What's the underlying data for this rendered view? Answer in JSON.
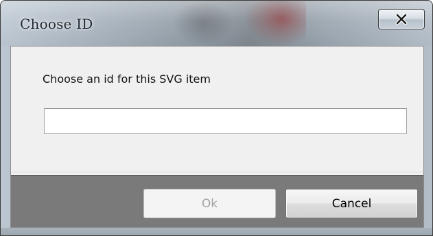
{
  "window": {
    "title": "Choose ID",
    "close_icon": "close-x-icon"
  },
  "dialog": {
    "prompt": "Choose an id for this SVG item",
    "input": {
      "value": "",
      "placeholder": ""
    },
    "buttons": {
      "ok_label": "Ok",
      "ok_enabled": false,
      "cancel_label": "Cancel"
    }
  },
  "colors": {
    "dialog_background": "#f0f0f0",
    "footer_background": "#7a7a7a",
    "disabled_text": "#a3a3a3"
  }
}
